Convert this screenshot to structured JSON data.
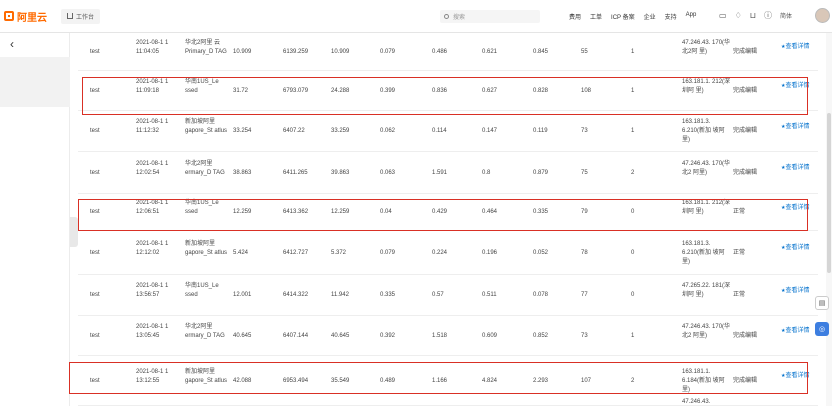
{
  "header": {
    "brand": "阿里云",
    "workspace": "工作台",
    "search_placeholder": "搜索",
    "nav": [
      "费用",
      "工单",
      "ICP 备案",
      "企业",
      "支持",
      "App"
    ],
    "icons": [
      "terminal-icon",
      "bell-icon",
      "cart-icon",
      "help-icon"
    ],
    "lang": "简体"
  },
  "table": {
    "link_star": "★",
    "rows": [
      {
        "name": "test",
        "time": "2021-08-1 1 11:04:05",
        "region": "华北2阿里 云Primary_D TAG",
        "v1": "10.909",
        "v2": "6139.259",
        "v3": "10.909",
        "v4": "0.079",
        "v5": "0.486",
        "v6": "0.621",
        "v7": "0.845",
        "v8": "55",
        "v9": "1",
        "ip": "47.246.43. 170(华北2阿 里)",
        "status": "完成编辑",
        "action": "查看详情"
      },
      {
        "name": "test",
        "time": "2021-08-1 1 11:09:18",
        "region": "华南1US_Le ssed",
        "v1": "31.72",
        "v2": "6793.079",
        "v3": "24.288",
        "v4": "0.399",
        "v5": "0.836",
        "v6": "0.627",
        "v7": "0.828",
        "v8": "108",
        "v9": "1",
        "ip": "163.181.1. 212(深圳阿 里)",
        "status": "完成编辑",
        "action": "查看详情"
      },
      {
        "name": "test",
        "time": "2021-08-1 1 11:12:32",
        "region": "新加坡阿里 gapore_St atlus",
        "v1": "33.254",
        "v2": "6407.22",
        "v3": "33.259",
        "v4": "0.062",
        "v5": "0.114",
        "v6": "0.147",
        "v7": "0.119",
        "v8": "73",
        "v9": "1",
        "ip": "163.181.3. 6.210(新加 坡阿里)",
        "status": "完成编辑",
        "action": "查看详情"
      },
      {
        "name": "test",
        "time": "2021-08-1 1 12:02:54",
        "region": "华北2阿里 ermary_D TAG",
        "v1": "38.863",
        "v2": "6411.265",
        "v3": "39.863",
        "v4": "0.063",
        "v5": "1.591",
        "v6": "0.8",
        "v7": "0.879",
        "v8": "75",
        "v9": "2",
        "ip": "47.246.43. 170(华北2 阿里)",
        "status": "完成编辑",
        "action": "查看详情"
      },
      {
        "name": "test",
        "time": "2021-08-1 1 12:06:51",
        "region": "华南1US_Le ssed",
        "v1": "12.259",
        "v2": "6413.362",
        "v3": "12.259",
        "v4": "0.04",
        "v5": "0.429",
        "v6": "0.464",
        "v7": "0.335",
        "v8": "79",
        "v9": "0",
        "ip": "163.181.1. 212(深圳阿 里)",
        "status": "正常",
        "action": "查看详情"
      },
      {
        "name": "test",
        "time": "2021-08-1 1 12:12:02",
        "region": "新加坡阿里 gapore_St atlus",
        "v1": "5.424",
        "v2": "6412.727",
        "v3": "5.372",
        "v4": "0.079",
        "v5": "0.224",
        "v6": "0.196",
        "v7": "0.052",
        "v8": "78",
        "v9": "0",
        "ip": "163.181.3. 6.210(新加 坡阿里)",
        "status": "正常",
        "action": "查看详情"
      },
      {
        "name": "test",
        "time": "2021-08-1 1 13:56:57",
        "region": "华南1US_Le ssed",
        "v1": "12.001",
        "v2": "6414.322",
        "v3": "11.942",
        "v4": "0.335",
        "v5": "0.57",
        "v6": "0.511",
        "v7": "0.078",
        "v8": "77",
        "v9": "0",
        "ip": "47.265.22. 181(深圳阿 里)",
        "status": "正常",
        "action": "查看详情"
      },
      {
        "name": "test",
        "time": "2021-08-1 1 13:05:45",
        "region": "华北2阿里 ermary_D TAG",
        "v1": "40.645",
        "v2": "6407.144",
        "v3": "40.645",
        "v4": "0.392",
        "v5": "1.518",
        "v6": "0.609",
        "v7": "0.852",
        "v8": "73",
        "v9": "1",
        "ip": "47.246.43. 170(华北2 阿里)",
        "status": "完成编辑",
        "action": "查看详情"
      },
      {
        "name": "test",
        "time": "2021-08-1 1 13:12:55",
        "region": "新加坡阿里 gapore_St atlus",
        "v1": "42.088",
        "v2": "6953.494",
        "v3": "35.549",
        "v4": "0.489",
        "v5": "1.166",
        "v6": "4.824",
        "v7": "2.293",
        "v8": "107",
        "v9": "2",
        "ip": "163.181.1. 6.184(新加 坡阿里)",
        "status": "完成编辑",
        "action": "查看详情"
      }
    ]
  },
  "partial_next_row_ip": "47.246.43."
}
